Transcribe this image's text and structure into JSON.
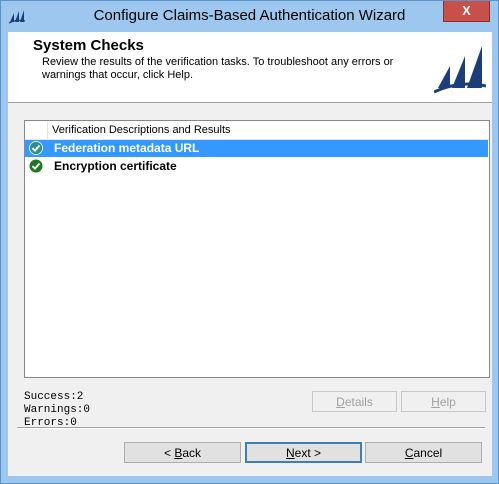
{
  "window": {
    "title": "Configure Claims-Based Authentication Wizard",
    "close_label": "X"
  },
  "header": {
    "title": "System Checks",
    "description": "Review the results of the verification tasks. To troubleshoot any errors or warnings that occur, click Help."
  },
  "list": {
    "column_header": "Verification Descriptions and Results",
    "rows": [
      {
        "label": "Federation metadata URL",
        "status": "success",
        "icon": "green-check-icon",
        "selected": true
      },
      {
        "label": "Encryption certificate",
        "status": "success",
        "icon": "green-check-icon",
        "selected": false
      }
    ]
  },
  "summary": {
    "success": "Success:2",
    "warnings": "Warnings:0",
    "errors": "Errors:0"
  },
  "buttons": {
    "details": {
      "pre": "",
      "key": "D",
      "post": "etails"
    },
    "help": {
      "pre": "",
      "key": "H",
      "post": "elp"
    },
    "back": {
      "pre": "< ",
      "key": "B",
      "post": "ack"
    },
    "next": {
      "pre": "",
      "key": "N",
      "post": "ext >"
    },
    "cancel": {
      "pre": "",
      "key": "C",
      "post": "ancel"
    }
  },
  "colors": {
    "selection": "#3399ff",
    "success_icon": "#1e7a1e",
    "titlebar": "#9dc7ef",
    "close": "#c7504b",
    "logo": "#1d3e79"
  }
}
